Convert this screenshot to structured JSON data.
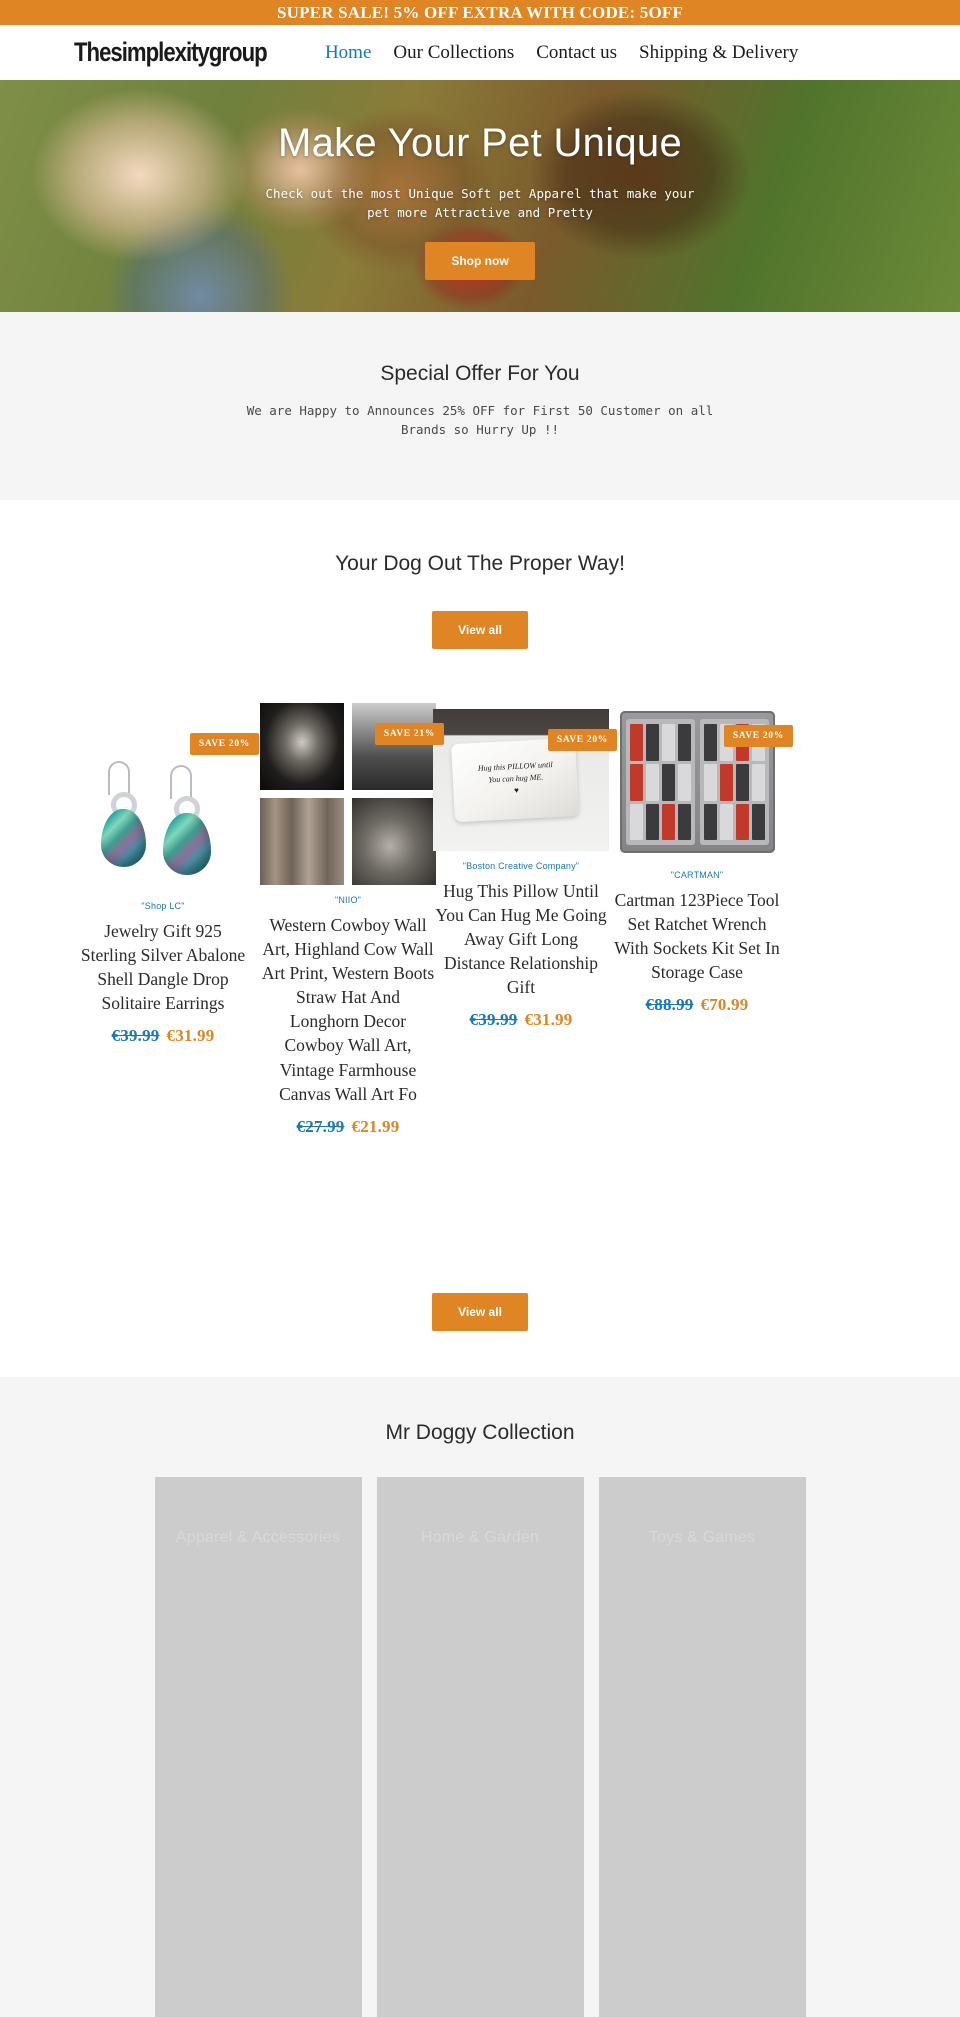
{
  "announcement": {
    "text": "SUPER SALE! 5% OFF EXTRA WITH CODE: 5OFF"
  },
  "header": {
    "logo": "Thesimplexitygroup",
    "nav": [
      {
        "label": "Home",
        "active": true
      },
      {
        "label": "Our Collections",
        "active": false
      },
      {
        "label": "Contact us",
        "active": false
      },
      {
        "label": "Shipping & Delivery",
        "active": false
      }
    ]
  },
  "hero": {
    "title": "Make Your Pet Unique",
    "subtitle": "Check out the most Unique Soft pet Apparel that make your pet more Attractive and Pretty",
    "cta": "Shop now"
  },
  "offer": {
    "title": "Special Offer For You",
    "body": "We are Happy to Announces 25% OFF for First 50 Customer on all Brands so Hurry Up !!"
  },
  "deals": {
    "title": "Your Dog Out The Proper Way!",
    "view_all_top": "View all",
    "view_all_bottom": "View all",
    "products": [
      {
        "badge": "SAVE 20%",
        "vendor": "\"Shop LC\"",
        "title": "Jewelry Gift 925 Sterling Silver Abalone Shell Dangle Drop Solitaire Earrings",
        "price_old": "€39.99",
        "price_new": "€31.99"
      },
      {
        "badge": "SAVE 21%",
        "vendor": "\"NIIO\"",
        "title": "Western Cowboy Wall Art, Highland Cow Wall Art Print, Western Boots Straw Hat And Longhorn Decor Cowboy Wall Art, Vintage Farmhouse Canvas Wall Art Fo",
        "price_old": "€27.99",
        "price_new": "€21.99"
      },
      {
        "badge": "SAVE 20%",
        "vendor": "\"Boston Creative Company\"",
        "title": "Hug This Pillow Until You Can Hug Me Going Away Gift Long Distance Relationship Gift",
        "price_old": "€39.99",
        "price_new": "€31.99",
        "pillow_line1": "Hug this PILLOW until",
        "pillow_line2": "You can hug ME.",
        "pillow_heart": "♥"
      },
      {
        "badge": "SAVE 20%",
        "vendor": "\"CARTMAN\"",
        "title": "Cartman 123Piece Tool Set Ratchet Wrench With Sockets Kit Set In Storage Case",
        "price_old": "€88.99",
        "price_new": "€70.99"
      }
    ]
  },
  "collection": {
    "title": "Mr Doggy Collection",
    "tiles": [
      {
        "label": "Apparel & Accessories"
      },
      {
        "label": "Home & Garden"
      },
      {
        "label": "Toys & Games"
      }
    ]
  },
  "colors": {
    "accent_orange": "#e08524",
    "link_blue": "#1878b9",
    "price_new": "#d98724",
    "section_gray": "#f5f5f5",
    "tile_gray": "#cccccc"
  }
}
